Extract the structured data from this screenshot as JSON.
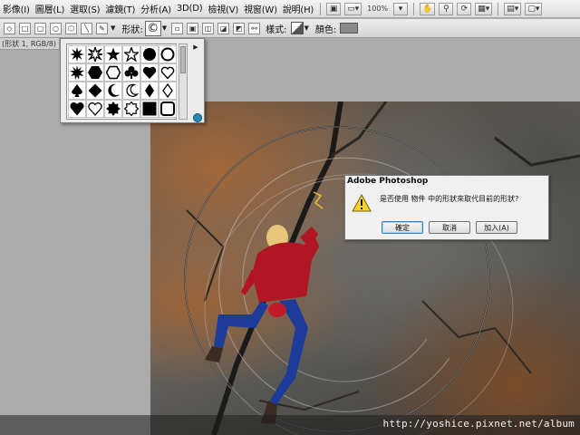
{
  "menubar": {
    "items": [
      "影像(I)",
      "圖層(L)",
      "選取(S)",
      "濾鏡(T)",
      "分析(A)",
      "3D(D)",
      "檢視(V)",
      "視窗(W)",
      "說明(H)"
    ],
    "zoom": "100%"
  },
  "options": {
    "shape_label": "形狀:",
    "style_label": "樣式:",
    "color_label": "顏色:",
    "color_value": "#888888"
  },
  "document": {
    "tab_label": "(形狀 1, RGB/8) *"
  },
  "shape_picker": {
    "shapes": [
      "starburst-24",
      "starburst-12",
      "star-5",
      "star-outline-5",
      "octagon-flower",
      "circle-outline",
      "starburst-20",
      "hexagon",
      "hexagon-outline",
      "club",
      "heart",
      "heart-outline",
      "spade",
      "diamond",
      "moon",
      "moon-outline",
      "diamond-filled",
      "diamond-outline",
      "heart-filled",
      "heart-outline-2",
      "burst-badge",
      "burst-badge-outline",
      "square",
      "square-rounded-outline"
    ]
  },
  "dialog": {
    "title": "Adobe Photoshop",
    "icon": "warning-icon",
    "message": "是否使用 物件 中的形狀來取代目前的形狀?",
    "ok_label": "確定",
    "cancel_label": "取消",
    "append_label": "加入(A)"
  },
  "watermark": "http://yoshice.pixnet.net/album"
}
